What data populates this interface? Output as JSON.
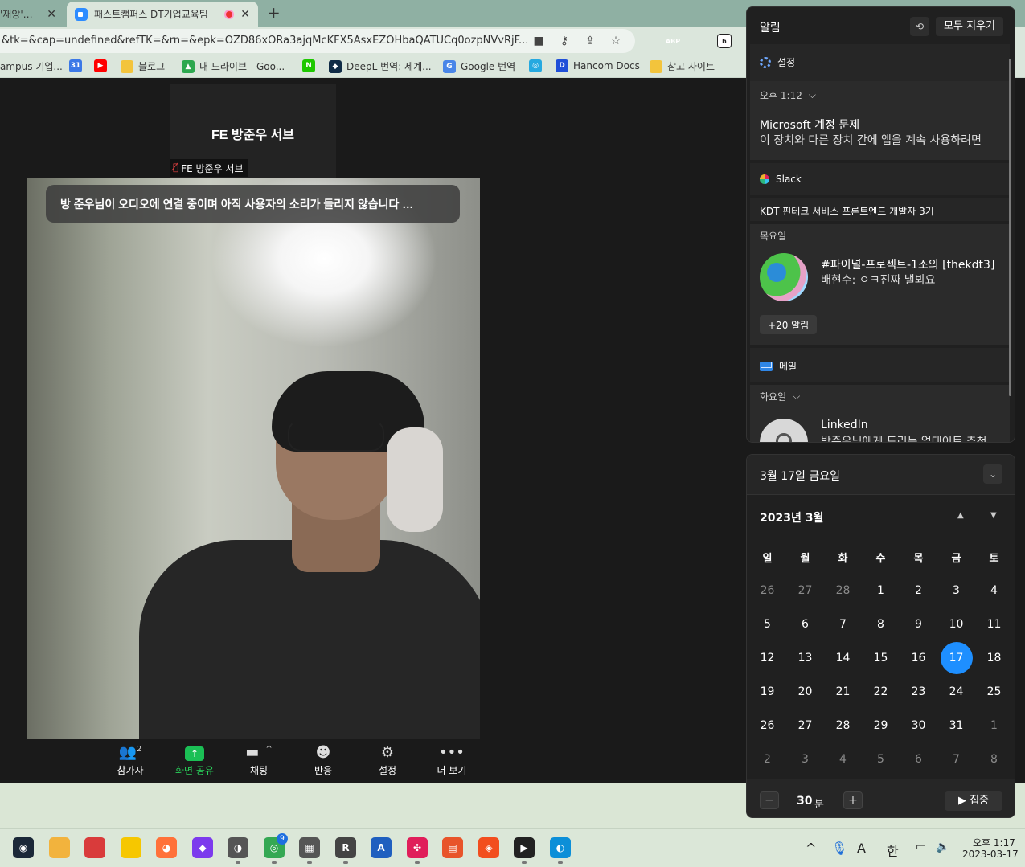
{
  "browser": {
    "tabs": [
      {
        "label": "'재앙'…",
        "active": false
      },
      {
        "label": "패스트캠퍼스 DT기업교육팀",
        "active": true
      }
    ],
    "new_tab": "+",
    "tab_close": "✕",
    "url": "&tk=&cap=undefined&refTK=&rn=&epk=OZD86xORa3ajqMcKFX5AsxEZOHbaQATUCq0ozpNVvRjF...",
    "toolbar_icons": [
      "camera-icon",
      "key-icon",
      "share-icon",
      "star-icon"
    ],
    "extensions": [
      {
        "name": "tab-ext",
        "text": "",
        "color": "#b0b0b0"
      },
      {
        "name": "abp-ext",
        "text": "ABP",
        "color": "#d9252a"
      },
      {
        "name": "shield-ext",
        "text": "",
        "color": "#3c6fd8"
      },
      {
        "name": "h-ext",
        "text": "h",
        "color": "#222222"
      }
    ],
    "bookmarks": [
      {
        "label": "ampus 기업...",
        "icon": "",
        "color": ""
      },
      {
        "label": "",
        "icon": "31",
        "color": "#3b78e7"
      },
      {
        "label": "",
        "icon": "▶",
        "color": "#ff0000"
      },
      {
        "label": "블로그",
        "icon": "",
        "color": "#f3c43c"
      },
      {
        "label": "내 드라이브 - Goo...",
        "icon": "▲",
        "color": "#2da84f"
      },
      {
        "label": "",
        "icon": "N",
        "color": "#1ec800"
      },
      {
        "label": "DeepL 번역: 세계...",
        "icon": "◆",
        "color": "#0f2b46"
      },
      {
        "label": "Google 번역",
        "icon": "G",
        "color": "#4a86e8"
      },
      {
        "label": "",
        "icon": "◎",
        "color": "#25a9e0"
      },
      {
        "label": "Hancom Docs",
        "icon": "D",
        "color": "#1f4fd8"
      },
      {
        "label": "참고 사이트",
        "icon": "",
        "color": "#f3c43c"
      }
    ]
  },
  "meeting": {
    "self_name": "FE 방준우 서브",
    "self_label": "FE 방준우 서브",
    "audio_banner": "방 준우님이 오디오에 연결 중이며 아직 사용자의 소리가 들리지 않습니다 …",
    "toolbar": [
      {
        "label": "참가자",
        "icon": "participants-icon",
        "badge": "2"
      },
      {
        "label": "화면 공유",
        "icon": "share-screen-icon",
        "badge": ""
      },
      {
        "label": "채팅",
        "icon": "chat-icon",
        "badge": "^"
      },
      {
        "label": "반응",
        "icon": "reaction-icon",
        "badge": ""
      },
      {
        "label": "설정",
        "icon": "settings-gear-icon",
        "badge": ""
      },
      {
        "label": "더 보기",
        "icon": "more-icon",
        "badge": ""
      }
    ]
  },
  "notifications": {
    "title": "알림",
    "clear_all": "모두 지우기",
    "settings_label": "설정",
    "ms_time": "오후 1:12",
    "ms_title": "Microsoft 계정 문제",
    "ms_body": "이 장치와 다른 장치 간에 앱을 계속 사용하려면",
    "slack_app": "Slack",
    "slack_workspace": "KDT 핀테크 서비스 프론트엔드 개발자 3기",
    "slack_day": "목요일",
    "slack_channel": "#파이널-프로젝트-1조의 [thekdt3]",
    "slack_message": "배현수: ㅇㅋ진짜 낼뵈요",
    "slack_more": "+20 알림",
    "mail_app": "메일",
    "mail_day": "화요일",
    "mail_sender": "LinkedIn",
    "mail_body": "방준우님에게 드리는 업데이트 추천"
  },
  "calendar": {
    "header_date": "3월 17일 금요일",
    "month_label": "2023년 3월",
    "weekdays": [
      "일",
      "월",
      "화",
      "수",
      "목",
      "금",
      "토"
    ],
    "days": [
      {
        "d": "26",
        "dim": true
      },
      {
        "d": "27",
        "dim": true
      },
      {
        "d": "28",
        "dim": true
      },
      {
        "d": "1"
      },
      {
        "d": "2"
      },
      {
        "d": "3"
      },
      {
        "d": "4"
      },
      {
        "d": "5"
      },
      {
        "d": "6"
      },
      {
        "d": "7"
      },
      {
        "d": "8"
      },
      {
        "d": "9"
      },
      {
        "d": "10"
      },
      {
        "d": "11"
      },
      {
        "d": "12"
      },
      {
        "d": "13"
      },
      {
        "d": "14"
      },
      {
        "d": "15"
      },
      {
        "d": "16"
      },
      {
        "d": "17",
        "today": true
      },
      {
        "d": "18"
      },
      {
        "d": "19"
      },
      {
        "d": "20"
      },
      {
        "d": "21"
      },
      {
        "d": "22"
      },
      {
        "d": "23"
      },
      {
        "d": "24"
      },
      {
        "d": "25"
      },
      {
        "d": "26"
      },
      {
        "d": "27"
      },
      {
        "d": "28"
      },
      {
        "d": "29"
      },
      {
        "d": "30"
      },
      {
        "d": "31"
      },
      {
        "d": "1",
        "dim": true
      },
      {
        "d": "2",
        "dim": true
      },
      {
        "d": "3",
        "dim": true
      },
      {
        "d": "4",
        "dim": true
      },
      {
        "d": "5",
        "dim": true
      },
      {
        "d": "6",
        "dim": true
      },
      {
        "d": "7",
        "dim": true
      },
      {
        "d": "8",
        "dim": true
      }
    ],
    "focus_minus": "−",
    "focus_plus": "+",
    "focus_minutes": "30",
    "focus_unit": "분",
    "focus_button": "▶ 집중"
  },
  "taskbar": {
    "apps": [
      {
        "name": "steam-icon",
        "glyph": "◉",
        "color": "#1b2838"
      },
      {
        "name": "file-explorer-icon",
        "glyph": "",
        "color": "#f2b33d"
      },
      {
        "name": "app-red-icon",
        "glyph": "",
        "color": "#d93b3b"
      },
      {
        "name": "sticky-notes-icon",
        "glyph": "",
        "color": "#f6c700"
      },
      {
        "name": "firefox-icon",
        "glyph": "◕",
        "color": "#ff7139"
      },
      {
        "name": "obsidian-icon",
        "glyph": "◆",
        "color": "#7c3aed"
      },
      {
        "name": "app-gray-icon",
        "glyph": "◑",
        "color": "#555555"
      },
      {
        "name": "chrome-icon",
        "glyph": "◎",
        "color": "#34a853"
      },
      {
        "name": "calculator-icon",
        "glyph": "▦",
        "color": "#555555"
      },
      {
        "name": "app-r-icon",
        "glyph": "R",
        "color": "#444444"
      },
      {
        "name": "app-a-icon",
        "glyph": "A",
        "color": "#1f5fbf"
      },
      {
        "name": "slack-icon",
        "glyph": "✣",
        "color": "#e01e5a"
      },
      {
        "name": "app-orange-icon",
        "glyph": "▤",
        "color": "#e8542a"
      },
      {
        "name": "figma-icon",
        "glyph": "◈",
        "color": "#f24e1e"
      },
      {
        "name": "app-box-icon",
        "glyph": "▶",
        "color": "#222222"
      },
      {
        "name": "edge-icon",
        "glyph": "◐",
        "color": "#0c8fd8"
      }
    ],
    "chrome_badge": "9",
    "tray_up": "^",
    "tray_ime_a": "A",
    "tray_ime_han": "한",
    "time": "오후 1:17",
    "date": "2023-03-17"
  }
}
